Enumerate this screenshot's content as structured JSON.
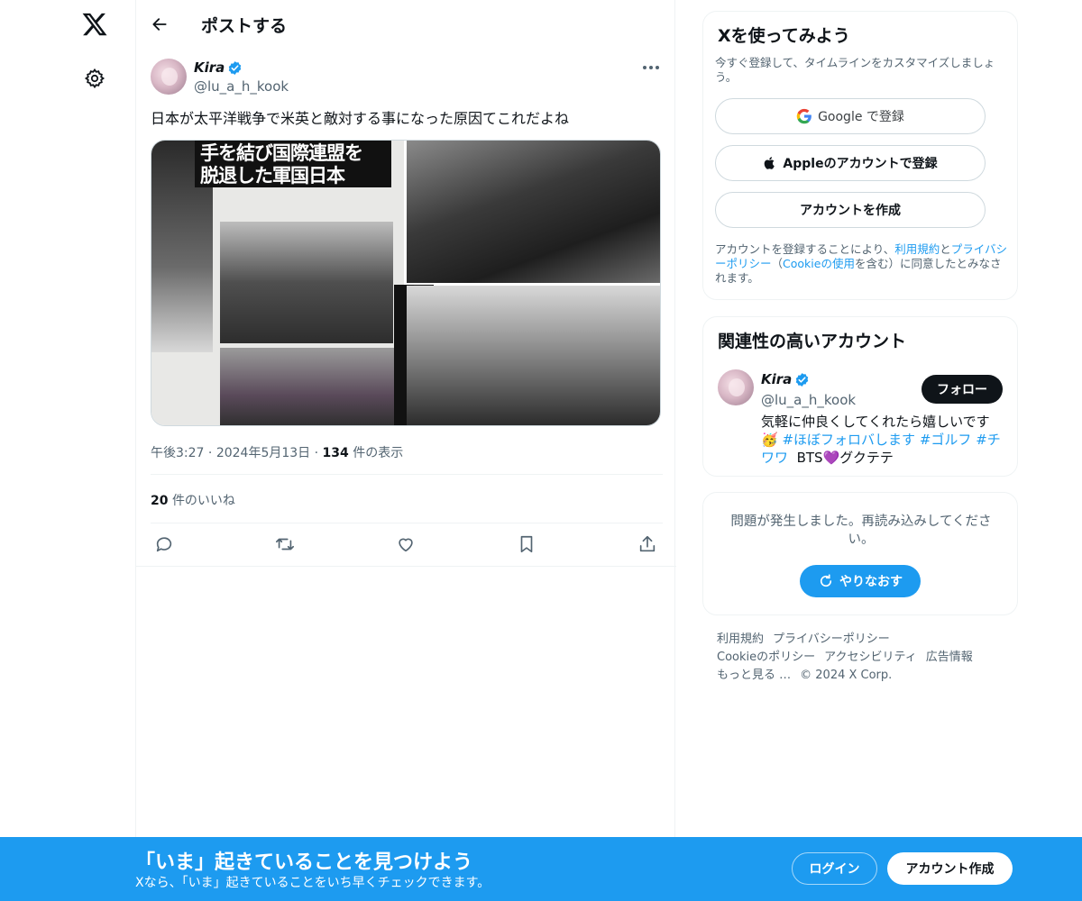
{
  "nav": {
    "logo": "x-logo-icon",
    "settings": "gear-icon"
  },
  "header": {
    "title": "ポストする",
    "back": "back-arrow-icon"
  },
  "post": {
    "author_name": "Kira",
    "author_handle": "@lu_a_h_kook",
    "text": "日本が太平洋戦争で米英と敵対する事になった原因てこれだよね",
    "media_headline_line1": "手を結び国際連盟を",
    "media_headline_line2": "脱退した軍国日本",
    "time": "午後3:27",
    "date": "2024年5月13日",
    "views_count": "134",
    "views_label": "件の表示",
    "likes_count": "20",
    "likes_label": "件のいいね"
  },
  "signup": {
    "title": "Xを使ってみよう",
    "subtitle": "今すぐ登録して、タイムラインをカスタマイズしましょう。",
    "google_label": "Google で登録",
    "apple_label": "Appleのアカウントで登録",
    "create_label": "アカウントを作成",
    "terms_pre": "アカウントを登録することにより、",
    "terms_link1": "利用規約",
    "terms_mid1": "と",
    "terms_link2": "プライバシーポリシー",
    "terms_mid2": "（",
    "terms_link3": "Cookieの使用",
    "terms_post": "を含む）に同意したとみなされます。"
  },
  "related": {
    "title": "関連性の高いアカウント",
    "name": "Kira",
    "handle": "@lu_a_h_kook",
    "follow_label": "フォロー",
    "bio_text": "気軽に仲良くしてくれたら嬉しいです",
    "bio_emoji": "🥳",
    "bio_tag1": "#ほぼフォロバします",
    "bio_tag2": "#ゴルフ",
    "bio_tag3": "#チワワ",
    "bio_tail": "BTS💜グクテテ"
  },
  "error": {
    "message": "問題が発生しました。再読み込みしてください。",
    "retry_label": "やりなおす"
  },
  "footer": {
    "links": [
      "利用規約",
      "プライバシーポリシー",
      "Cookieのポリシー",
      "アクセシビリティ",
      "広告情報",
      "もっと見る …",
      "© 2024 X Corp."
    ]
  },
  "banner": {
    "title": "「いま」起きていることを見つけよう",
    "subtitle": "Xなら、「いま」起きていることをいち早くチェックできます。",
    "login_label": "ログイン",
    "create_label": "アカウント作成"
  },
  "colors": {
    "accent": "#1d9bf0",
    "text": "#0f1419",
    "muted": "#536471",
    "border": "#eff3f4"
  }
}
